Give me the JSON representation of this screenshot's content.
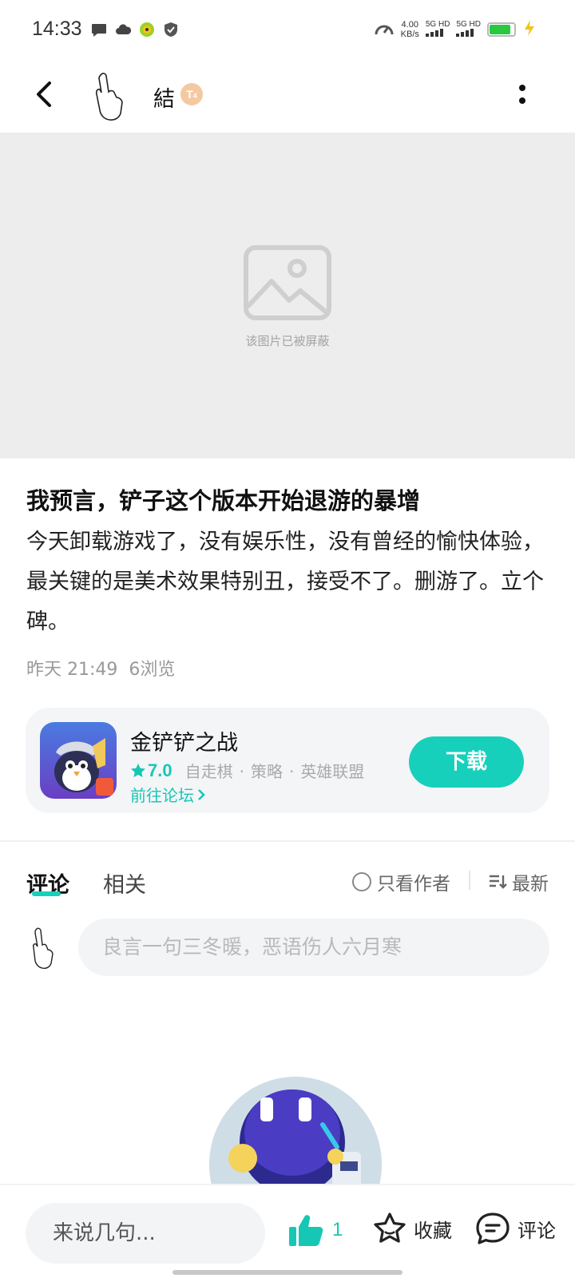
{
  "status_bar": {
    "time": "14:33",
    "net_speed_value": "4.00",
    "net_speed_unit": "KB/s",
    "sim1": "5G HD",
    "sim2": "5G HD",
    "battery_level": 0.85,
    "battery_color": "#27c93f"
  },
  "header": {
    "author_name": "結",
    "badge_text": "T",
    "badge_sub": "4"
  },
  "hero": {
    "caption": "该图片已被屏蔽"
  },
  "post": {
    "title": "我预言，铲子这个版本开始退游的暴增",
    "body": "今天卸载游戏了，没有娱乐性，没有曾经的愉快体验，最关键的是美术效果特别丑，接受不了。删游了。立个碑。",
    "time": "昨天 21:49",
    "views": "6浏览"
  },
  "game_card": {
    "name": "金铲铲之战",
    "rating": "7.0",
    "tags": [
      "自走棋",
      "策略",
      "英雄联盟"
    ],
    "forum_link": "前往论坛",
    "download_label": "下载"
  },
  "comments": {
    "tab_comments": "评论",
    "tab_related": "相关",
    "only_author": "只看作者",
    "sort_label": "最新",
    "input_placeholder": "良言一句三冬暖，恶语伤人六月寒"
  },
  "bottom_bar": {
    "input_placeholder": "来说几句...",
    "like_count": "1",
    "favorite_label": "收藏",
    "comment_label": "评论"
  },
  "colors": {
    "accent": "#17d0bb",
    "text_primary": "#111111",
    "text_secondary": "#999999"
  }
}
